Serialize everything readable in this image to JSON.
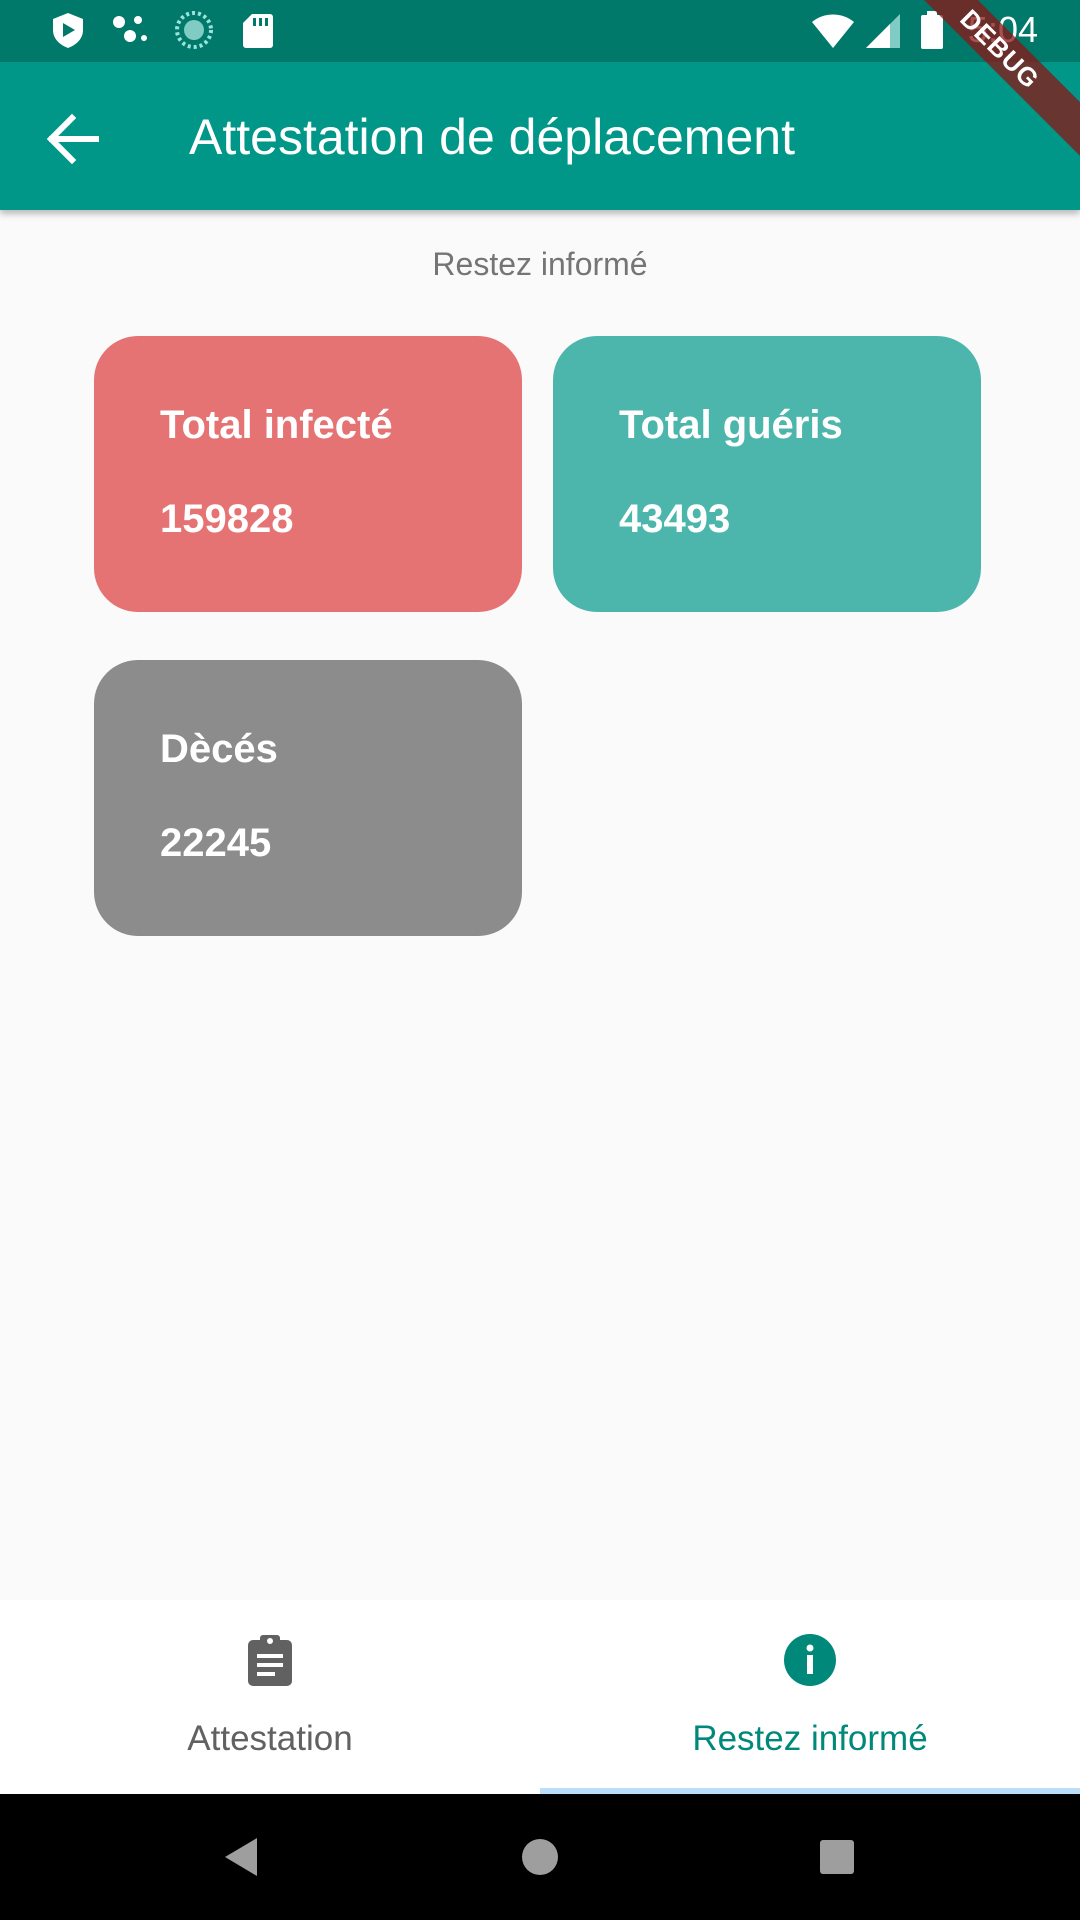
{
  "status_bar": {
    "time": "5:04",
    "left_icons": [
      "shield-icon",
      "dots-icon",
      "sync-icon",
      "sd-card-icon"
    ],
    "right_icons": [
      "wifi-icon",
      "signal-icon",
      "battery-icon"
    ]
  },
  "debug_banner": "DEBUG",
  "app_bar": {
    "title": "Attestation de déplacement",
    "back_icon": "arrow-back-icon"
  },
  "main": {
    "section_title": "Restez informé",
    "cards": [
      {
        "label": "Total infecté",
        "value": "159828",
        "color": "#e57373"
      },
      {
        "label": "Total guéris",
        "value": "43493",
        "color": "#4db6ac"
      },
      {
        "label": "Dècés",
        "value": "22245",
        "color": "#8c8c8c"
      }
    ]
  },
  "bottom_nav": {
    "items": [
      {
        "label": "Attestation",
        "icon": "clipboard-icon",
        "selected": false
      },
      {
        "label": "Restez informé",
        "icon": "info-icon",
        "selected": true
      }
    ],
    "active_color": "#00897b"
  },
  "system_nav": [
    "back-triangle-icon",
    "home-circle-icon",
    "recents-square-icon"
  ],
  "colors": {
    "primary": "#009688",
    "primary_dark": "#00796b",
    "background": "#fafafa"
  }
}
